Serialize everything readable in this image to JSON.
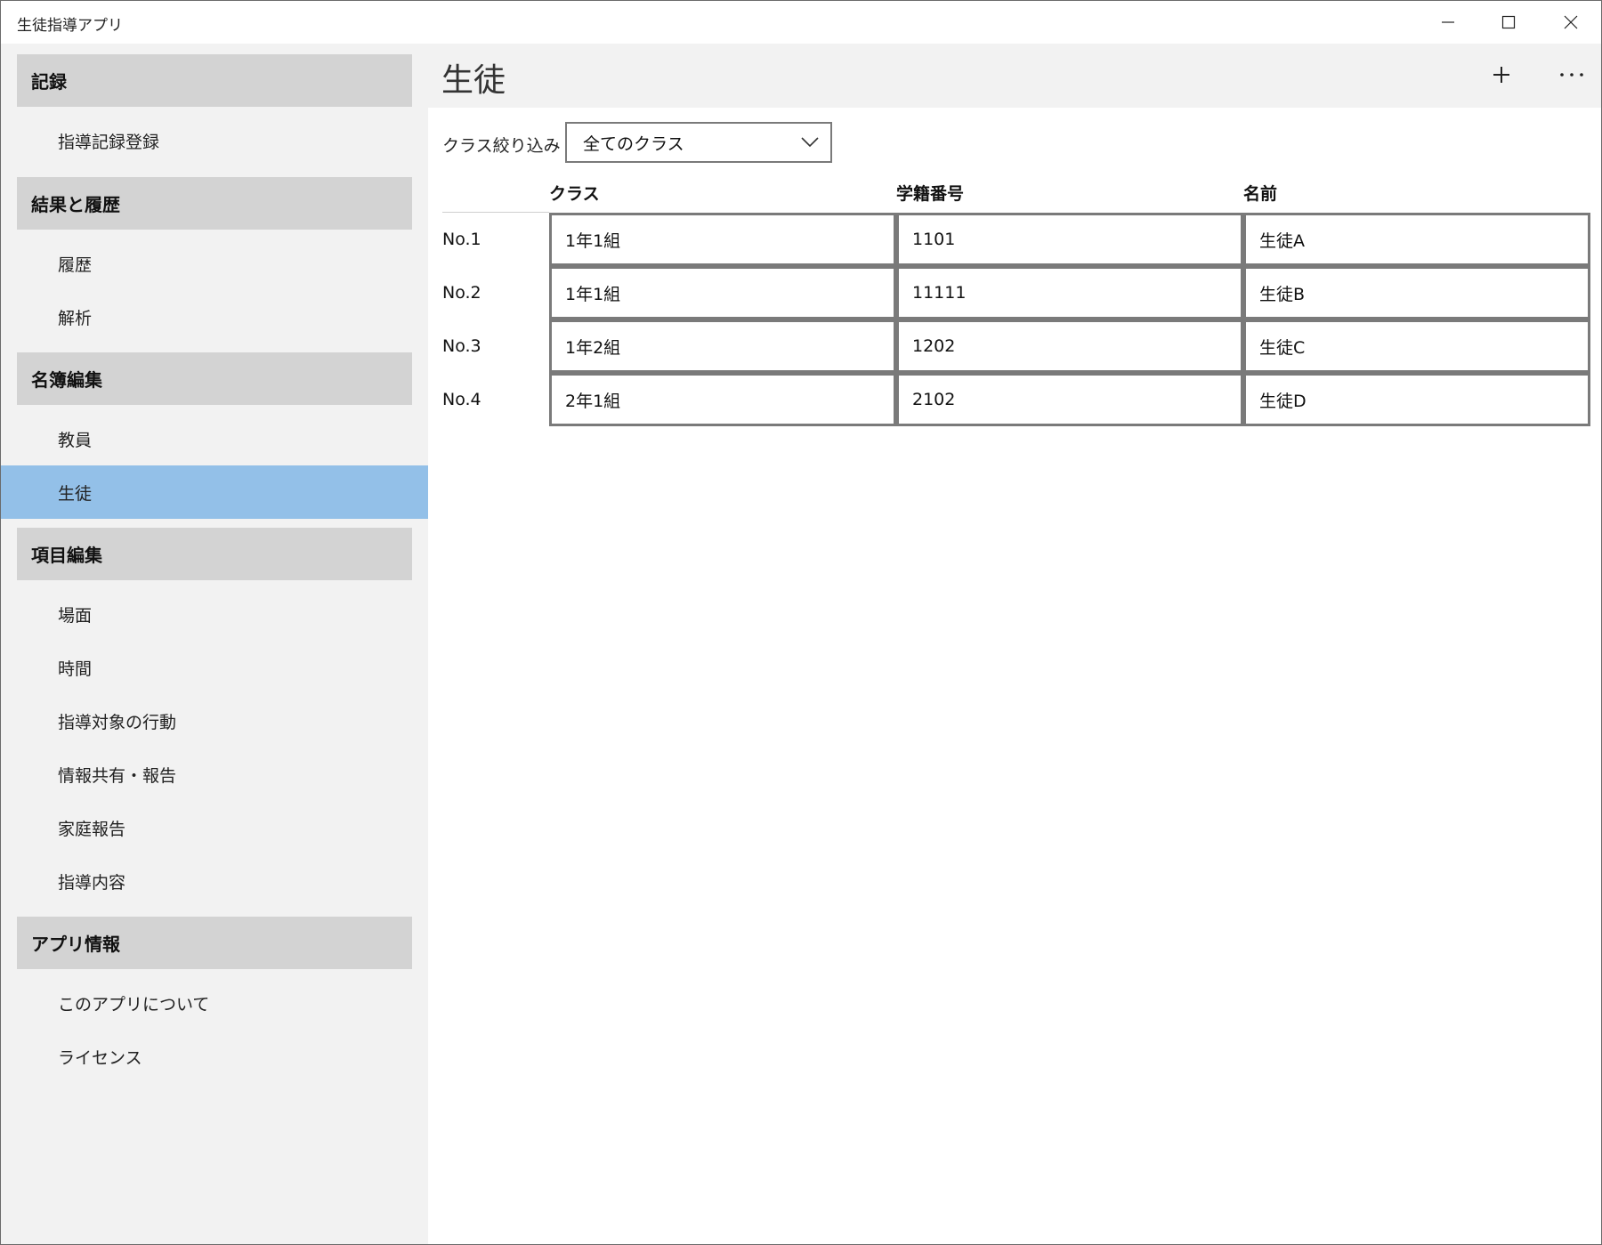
{
  "window": {
    "title": "生徒指導アプリ"
  },
  "sidebar": {
    "sections": [
      {
        "header": "記録",
        "items": [
          "指導記録登録"
        ]
      },
      {
        "header": "結果と履歴",
        "items": [
          "履歴",
          "解析"
        ]
      },
      {
        "header": "名簿編集",
        "items": [
          "教員",
          "生徒"
        ]
      },
      {
        "header": "項目編集",
        "items": [
          "場面",
          "時間",
          "指導対象の行動",
          "情報共有・報告",
          "家庭報告",
          "指導内容"
        ]
      },
      {
        "header": "アプリ情報",
        "items": [
          "このアプリについて",
          "ライセンス"
        ]
      }
    ],
    "selected_item": "生徒",
    "selected_color": "#93c0e8"
  },
  "main": {
    "title": "生徒",
    "add_icon": "plus-icon",
    "more_icon": "more-icon",
    "filter": {
      "label": "クラス絞り込み",
      "selected": "全てのクラス"
    },
    "table": {
      "columns": [
        "クラス",
        "学籍番号",
        "名前"
      ],
      "rows": [
        {
          "label": "No.1",
          "class": "1年1組",
          "id": "1101",
          "name": "生徒A"
        },
        {
          "label": "No.2",
          "class": "1年1組",
          "id": "11111",
          "name": "生徒B"
        },
        {
          "label": "No.3",
          "class": "1年2組",
          "id": "1202",
          "name": "生徒C"
        },
        {
          "label": "No.4",
          "class": "2年1組",
          "id": "2102",
          "name": "生徒D"
        }
      ]
    }
  }
}
